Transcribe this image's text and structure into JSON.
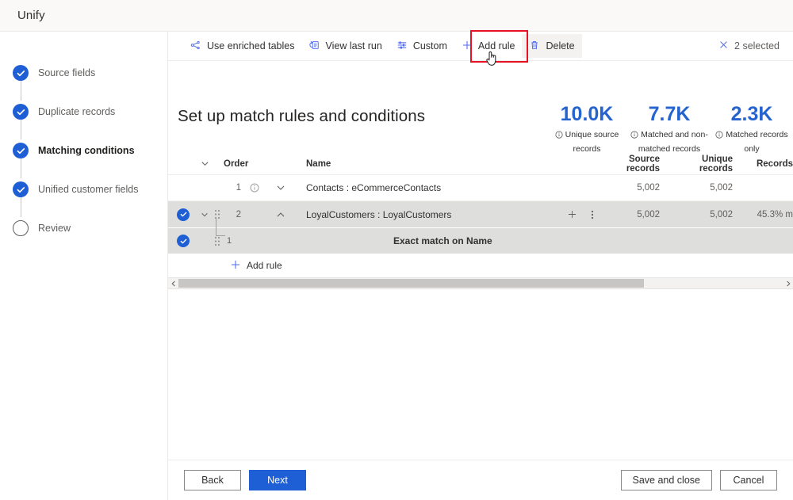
{
  "app": {
    "title": "Unify"
  },
  "stepper": {
    "items": [
      {
        "label": "Source fields",
        "state": "done"
      },
      {
        "label": "Duplicate records",
        "state": "done"
      },
      {
        "label": "Matching conditions",
        "state": "current"
      },
      {
        "label": "Unified customer fields",
        "state": "done"
      },
      {
        "label": "Review",
        "state": "todo"
      }
    ]
  },
  "toolbar": {
    "commands": [
      {
        "label": "Use enriched tables",
        "icon": "enriched-tables-icon"
      },
      {
        "label": "View last run",
        "icon": "view-last-run-icon"
      },
      {
        "label": "Custom",
        "icon": "sliders-icon"
      },
      {
        "label": "Add rule",
        "icon": "plus-icon"
      },
      {
        "label": "Delete",
        "icon": "trash-icon"
      }
    ],
    "selection_label": "2 selected",
    "selection_close_icon": "close-icon",
    "highlight_color": "#e81123"
  },
  "page": {
    "title": "Set up match rules and conditions"
  },
  "kpis": [
    {
      "value": "10.0K",
      "label": "Unique source records"
    },
    {
      "value": "7.7K",
      "label": "Matched and non-matched records"
    },
    {
      "value": "2.3K",
      "label": "Matched records only"
    }
  ],
  "table": {
    "headers": {
      "order": "Order",
      "name": "Name",
      "source_records": "Source records",
      "unique_records": "Unique records",
      "records": "Records"
    },
    "rows": [
      {
        "order": "1",
        "name": "Contacts : eCommerceContacts",
        "source_records": "5,002",
        "unique_records": "5,002",
        "records": ""
      },
      {
        "order": "2",
        "name": "LoyalCustomers : LoyalCustomers",
        "source_records": "5,002",
        "unique_records": "5,002",
        "records": "45.3% m"
      },
      {
        "order": "1",
        "name": "Exact match on Name",
        "source_records": "",
        "unique_records": "",
        "records": ""
      }
    ],
    "add_rule_label": "Add rule"
  },
  "footer": {
    "back": "Back",
    "next": "Next",
    "save_and_close": "Save and close",
    "cancel": "Cancel"
  },
  "colors": {
    "accent": "#1f5fd6",
    "kpi": "#2564cf",
    "annotation": "#e81123"
  }
}
